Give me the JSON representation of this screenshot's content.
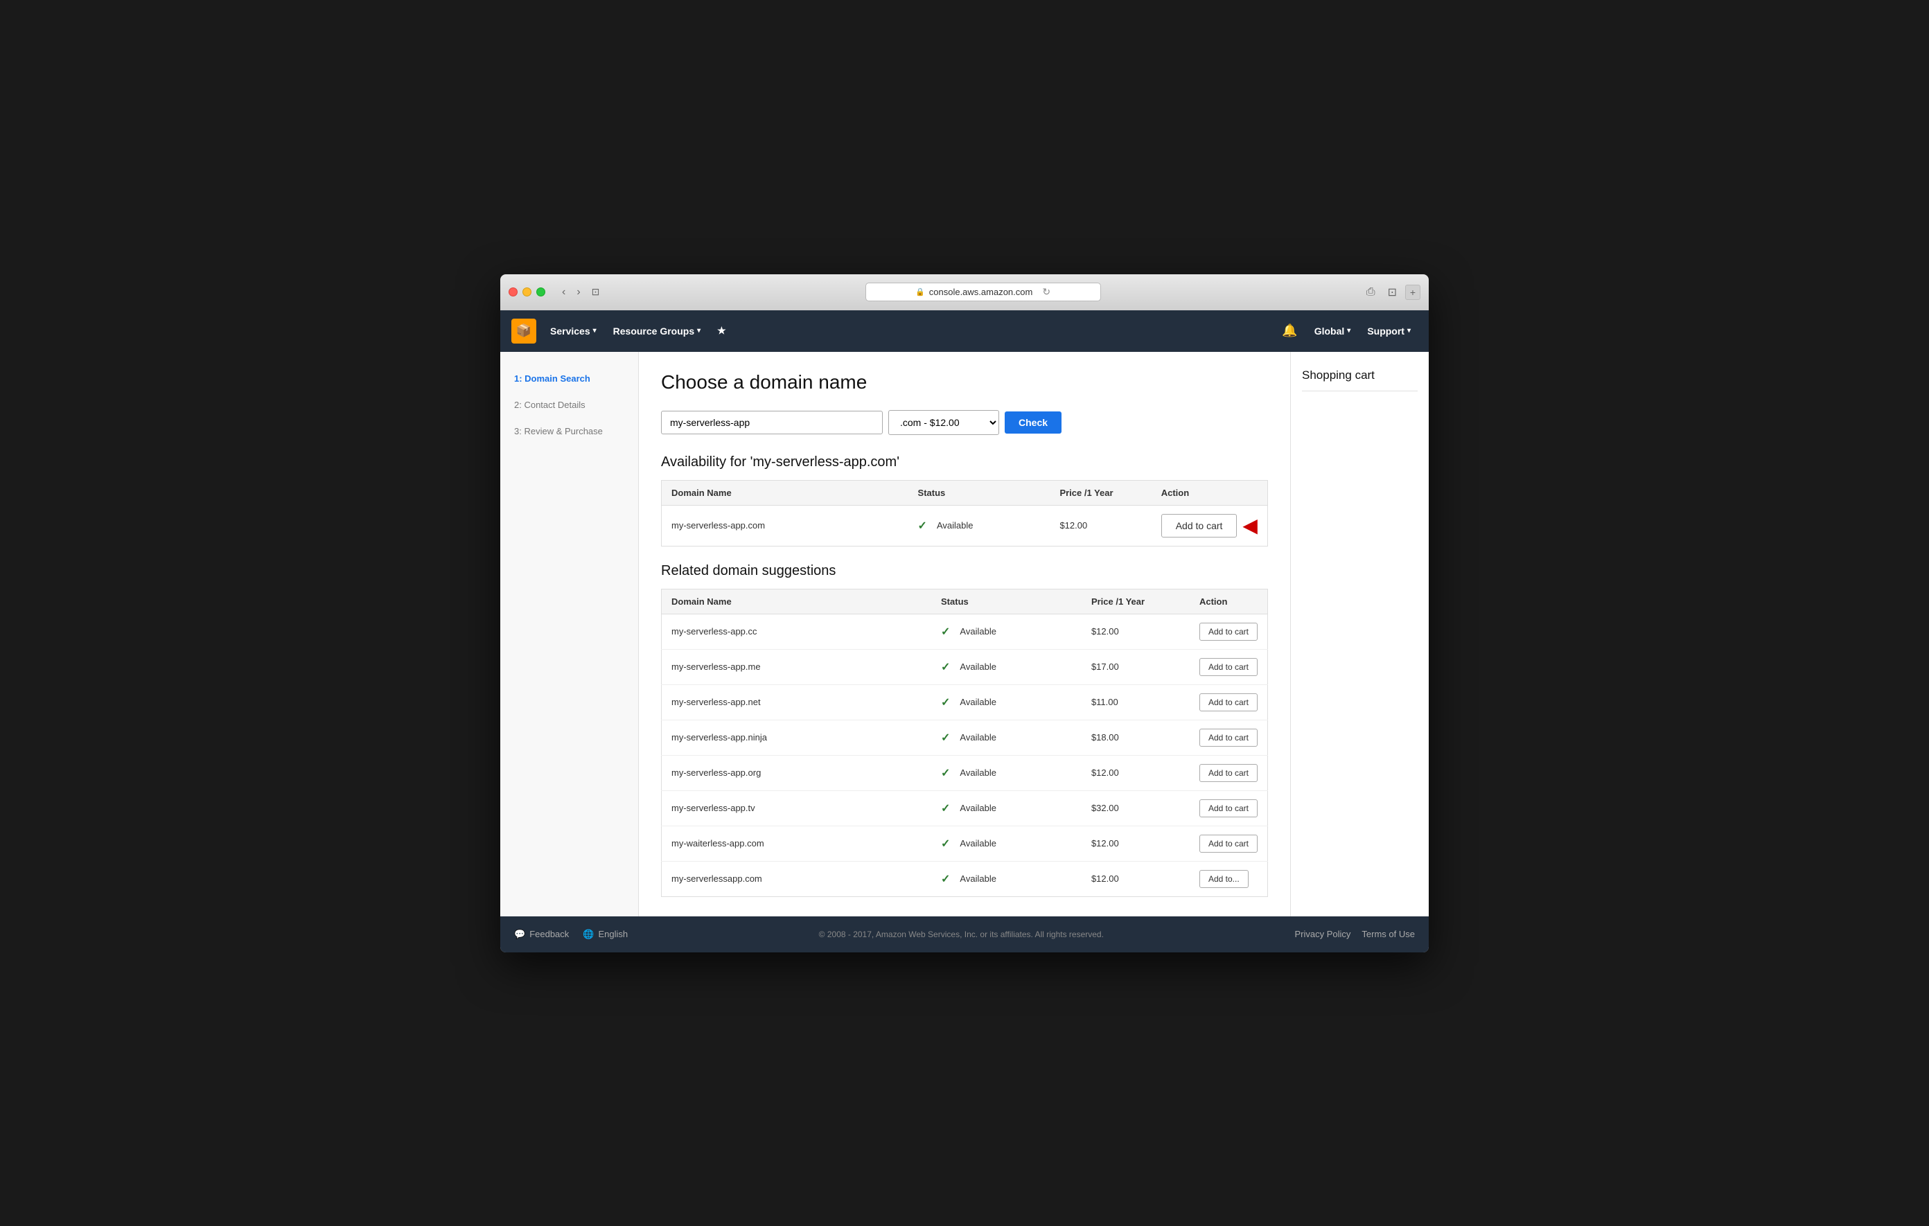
{
  "browser": {
    "url": "console.aws.amazon.com",
    "back_label": "‹",
    "forward_label": "›",
    "window_label": "⊡",
    "refresh_label": "↻",
    "share_label": "⎙",
    "fullscreen_label": "⊡",
    "plus_label": "+"
  },
  "topnav": {
    "services_label": "Services",
    "resource_groups_label": "Resource Groups",
    "pin_label": "★",
    "bell_label": "🔔",
    "global_label": "Global",
    "support_label": "Support",
    "chevron": "▾"
  },
  "sidebar": {
    "steps": [
      {
        "id": "step1",
        "label": "1: Domain Search",
        "active": true
      },
      {
        "id": "step2",
        "label": "2: Contact Details",
        "active": false
      },
      {
        "id": "step3",
        "label": "3: Review & Purchase",
        "active": false
      }
    ]
  },
  "main": {
    "page_title": "Choose a domain name",
    "search": {
      "domain_value": "my-serverless-app",
      "domain_placeholder": "my-serverless-app",
      "tld_option": ".com - $12.00",
      "check_button": "Check"
    },
    "availability": {
      "section_title": "Availability for 'my-serverless-app.com'",
      "table_headers": {
        "domain_name": "Domain Name",
        "status": "Status",
        "price_year": "Price /1 Year",
        "action": "Action"
      },
      "result": {
        "domain": "my-serverless-app.com",
        "status": "Available",
        "price": "$12.00",
        "action": "Add to cart"
      }
    },
    "suggestions": {
      "section_title": "Related domain suggestions",
      "table_headers": {
        "domain_name": "Domain Name",
        "status": "Status",
        "price_year": "Price /1 Year",
        "action": "Action"
      },
      "items": [
        {
          "domain": "my-serverless-app.cc",
          "status": "Available",
          "price": "$12.00",
          "action": "Add to cart"
        },
        {
          "domain": "my-serverless-app.me",
          "status": "Available",
          "price": "$17.00",
          "action": "Add to cart"
        },
        {
          "domain": "my-serverless-app.net",
          "status": "Available",
          "price": "$11.00",
          "action": "Add to cart"
        },
        {
          "domain": "my-serverless-app.ninja",
          "status": "Available",
          "price": "$18.00",
          "action": "Add to cart"
        },
        {
          "domain": "my-serverless-app.org",
          "status": "Available",
          "price": "$12.00",
          "action": "Add to cart"
        },
        {
          "domain": "my-serverless-app.tv",
          "status": "Available",
          "price": "$32.00",
          "action": "Add to cart"
        },
        {
          "domain": "my-waiterless-app.com",
          "status": "Available",
          "price": "$12.00",
          "action": "Add to cart"
        },
        {
          "domain": "my-serverlessapp.com",
          "status": "Available",
          "price": "$12.00",
          "action": "Add to..."
        }
      ]
    }
  },
  "cart": {
    "title": "Shopping cart"
  },
  "footer": {
    "feedback_label": "Feedback",
    "english_label": "English",
    "copyright": "© 2008 - 2017, Amazon Web Services, Inc. or its affiliates. All rights reserved.",
    "privacy_policy": "Privacy Policy",
    "terms_of_use": "Terms of Use"
  }
}
